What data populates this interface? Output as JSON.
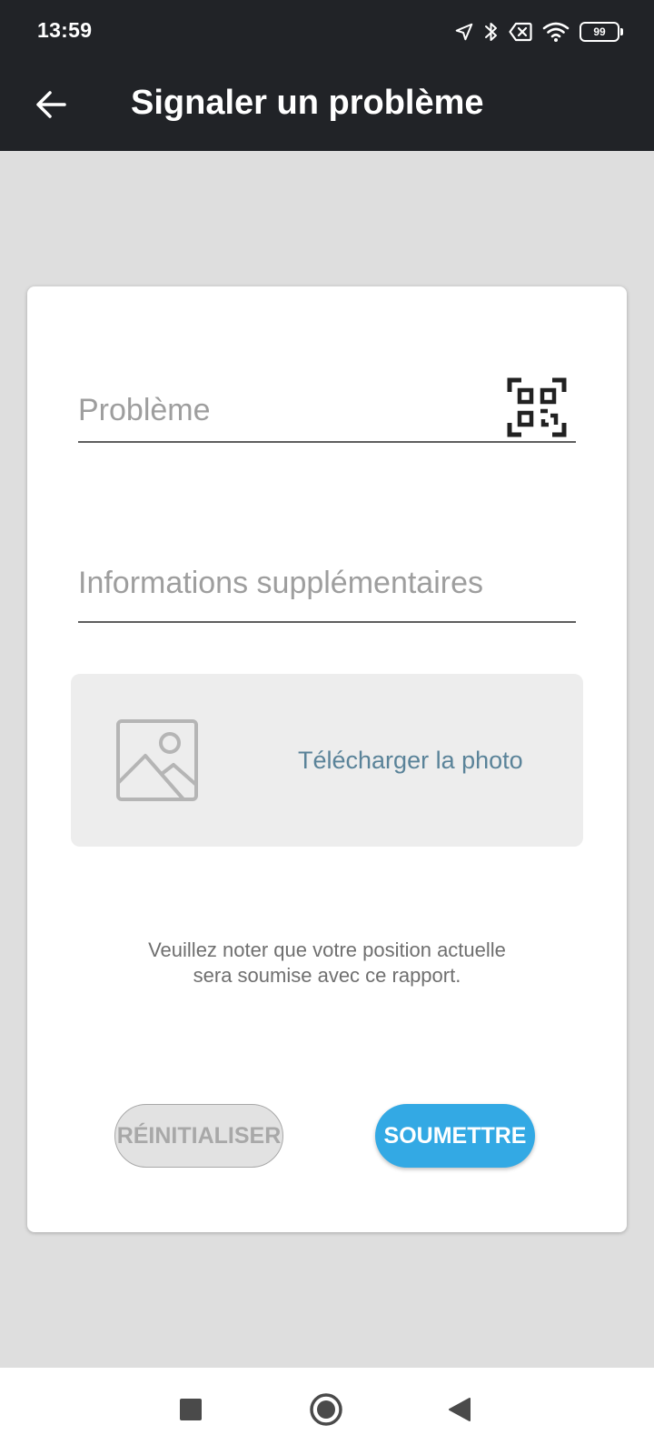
{
  "status_bar": {
    "time": "13:59",
    "battery_level": "99",
    "icons": [
      "location-arrow-icon",
      "bluetooth-icon",
      "no-sim-icon",
      "wifi-icon",
      "battery-icon"
    ]
  },
  "app_bar": {
    "title": "Signaler un problème",
    "back_icon": "arrow-left-icon"
  },
  "form": {
    "problem_placeholder": "Problème",
    "problem_value": "",
    "qr_icon": "qr-scan-icon",
    "info_placeholder": "Informations supplémentaires",
    "info_value": "",
    "photo_icon": "image-placeholder-icon",
    "photo_label": "Télécharger la photo",
    "notice": "Veuillez noter que votre position actuelle sera soumise avec ce rapport.",
    "reset_label": "RÉINITIALISER",
    "submit_label": "SOUMETTRE"
  },
  "nav_bar": {
    "icons": [
      "square-recent-icon",
      "circle-home-icon",
      "triangle-back-icon"
    ]
  },
  "colors": {
    "app_bar": "#212327",
    "background": "#dedede",
    "accent": "#33a9e4",
    "photo_label": "#5a8399"
  }
}
